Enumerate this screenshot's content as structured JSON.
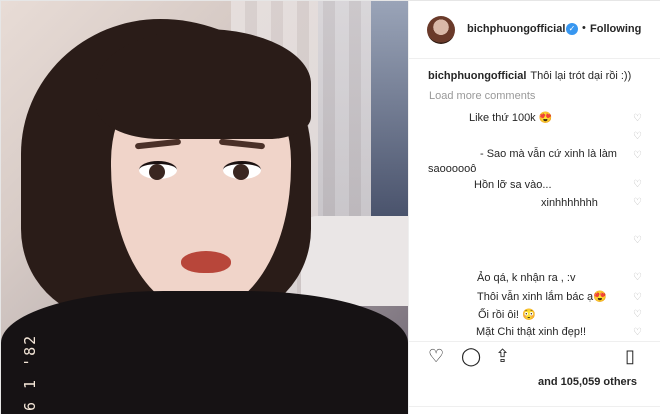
{
  "header": {
    "username": "bichphuongofficial",
    "verified_icon": "✓",
    "separator": "•",
    "follow_state": "Following"
  },
  "photo": {
    "date_stamp": "6 1 '82"
  },
  "caption": {
    "username": "bichphuongofficial",
    "text": "Thôi lại trót dại rồi :))"
  },
  "load_more": "Load more comments",
  "comments": [
    {
      "text": "Like thứ 100k 😍"
    },
    {
      "text": "- Sao mà vẫn cứ xinh là làm"
    },
    {
      "text": "saoooooô"
    },
    {
      "text": "Hồn lỡ sa vào..."
    },
    {
      "text": "xinhhhhhhh"
    },
    {
      "text": "Ảo qá, k nhận ra , :v"
    },
    {
      "text": "Thôi vẫn xinh lắm bác ạ😍"
    },
    {
      "text": "Ối rồi ôi! 😳"
    },
    {
      "text": "Mặt Chi thật xinh đẹp!!"
    }
  ],
  "likes_text": "and 105,059 others",
  "icons": {
    "heart": "heart-icon",
    "comment": "comment-icon",
    "share": "share-icon",
    "bookmark": "bookmark-icon"
  }
}
